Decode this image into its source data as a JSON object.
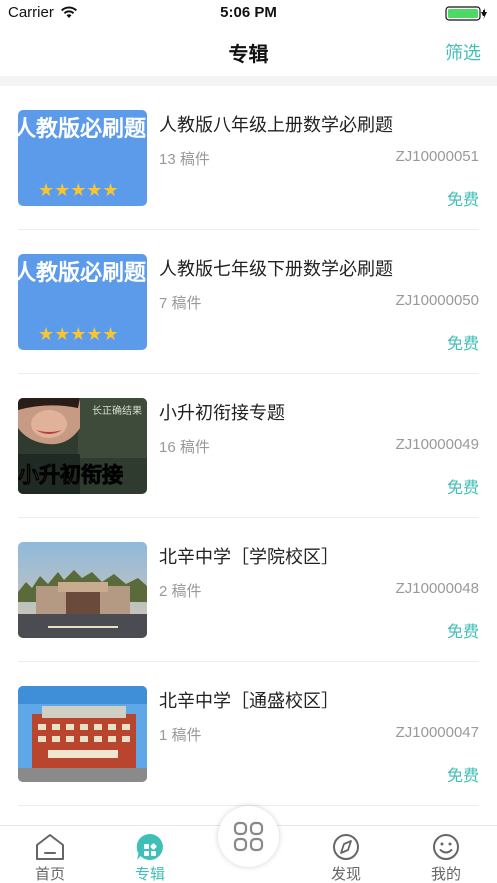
{
  "status_bar": {
    "carrier": "Carrier",
    "time": "5:06 PM"
  },
  "nav": {
    "title": "专辑",
    "filter_label": "筛选"
  },
  "colors": {
    "accent": "#3fbfb8",
    "muted_text": "#999999"
  },
  "albums": [
    {
      "title": "人教版八年级上册数学必刷题",
      "count": "13 稿件",
      "code": "ZJ10000051",
      "price": "免费",
      "thumb_text": "人教版必刷题",
      "thumb_stars": "★★★★★"
    },
    {
      "title": "人教版七年级下册数学必刷题",
      "count": "7 稿件",
      "code": "ZJ10000050",
      "price": "免费",
      "thumb_text": "人教版必刷题",
      "thumb_stars": "★★★★★"
    },
    {
      "title": "小升初衔接专题",
      "count": "16 稿件",
      "code": "ZJ10000049",
      "price": "免费",
      "thumb_text": "小升初衔接"
    },
    {
      "title": "北辛中学［学院校区］",
      "count": "2 稿件",
      "code": "ZJ10000048",
      "price": "免费"
    },
    {
      "title": "北辛中学［通盛校区］",
      "count": "1 稿件",
      "code": "ZJ10000047",
      "price": "免费"
    }
  ],
  "tabbar": {
    "home": "首页",
    "albums": "专辑",
    "discover": "发现",
    "mine": "我的"
  }
}
